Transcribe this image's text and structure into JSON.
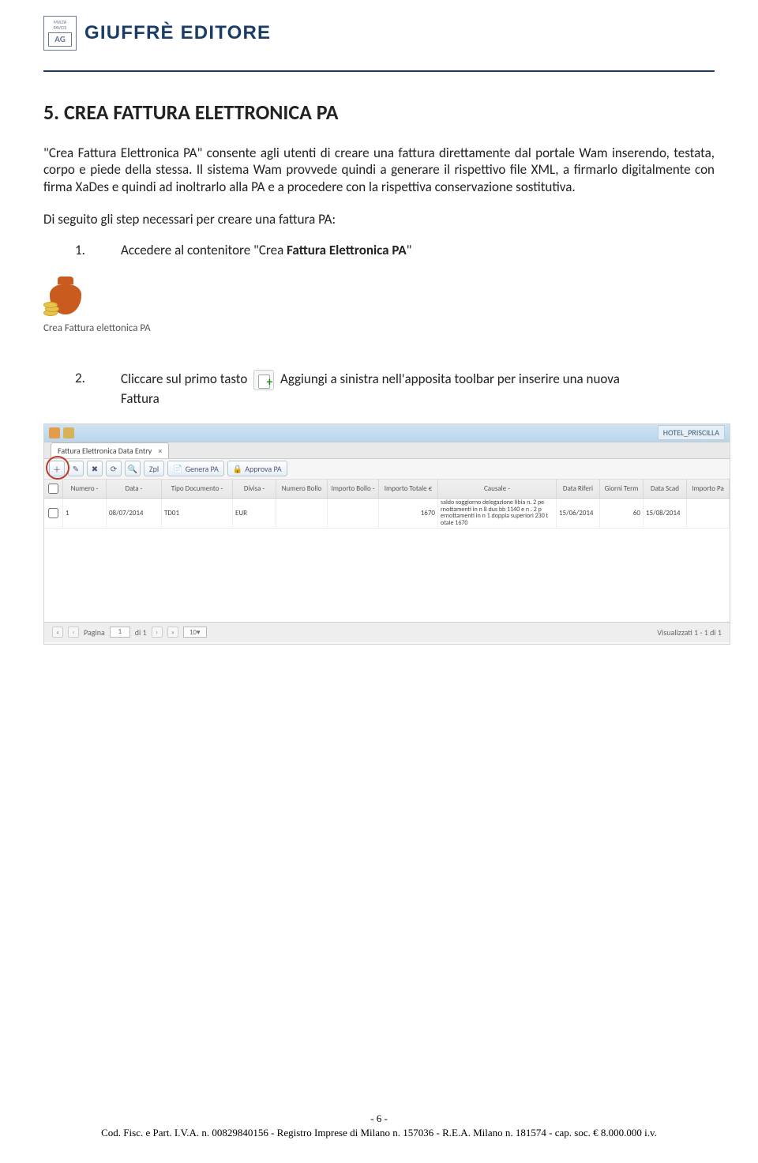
{
  "header": {
    "logo_small_top": "MVLTA",
    "logo_small_bottom": "PAVCIS",
    "logo_ag": "AG",
    "brand": "GIUFFRÈ EDITORE"
  },
  "title": "5. CREA FATTURA ELETTRONICA PA",
  "paragraph": "\"Crea Fattura Elettronica PA\" consente agli utenti di creare una fattura direttamente dal portale Wam inserendo, testata, corpo e piede della stessa. Il sistema Wam provvede quindi a generare il rispettivo file XML, a firmarlo digitalmente con firma XaDes e quindi ad inoltrarlo alla PA e a procedere con la rispettiva conservazione sostitutiva.",
  "step_lead": "Di seguito gli step necessari per creare una fattura PA:",
  "steps": {
    "one_num": "1.",
    "one_pre": "Accedere al contenitore \"Crea ",
    "one_bold": "Fattura Elettronica PA",
    "one_post": "\"",
    "icon_label": "Crea Fattura elettonica PA",
    "two_num": "2.",
    "two_pre": "Cliccare sul primo tasto ",
    "two_post": " Aggiungi a sinistra nell'apposita toolbar per inserire una nuova",
    "two_line2": "Fattura"
  },
  "app": {
    "right_label": "HOTEL_PRISCILLA",
    "tab_title": "Fattura Elettronica Data Entry",
    "toolbar": {
      "zpl": "Zpl",
      "genera": "Genera PA",
      "approva": "Approva PA"
    },
    "cols": {
      "numero": "Numero -",
      "data": "Data -",
      "tipo": "Tipo Documento - ",
      "divisa": "Divisa - ",
      "nbollo": "Numero Bollo",
      "ibollo": "Importo Bollo -",
      "itot": "Importo Totale €",
      "causale": "Causale - ",
      "datarif": "Data Riferi",
      "giorni": "Giorni Term",
      "datascad": "Data Scad",
      "ipa": "Importo Pa"
    },
    "row": {
      "numero": "1",
      "data": "08/07/2014",
      "tipo": "TD01",
      "divisa": "EUR",
      "nbollo": "",
      "ibollo": "",
      "itot": "1670",
      "causale": "saldo soggiorno delegazione libia  n. 2 pe rnottamenti in n 8 dus bb  1140  e n . 2 p ernottamenti in n 1 doppia superiori 230 t otale 1670",
      "datarif": "15/06/2014",
      "giorni": "60",
      "datascad": "15/08/2014",
      "ipa": ""
    },
    "pager": {
      "label_pagina": "Pagina",
      "cur": "1",
      "di": "di 1",
      "size": "10",
      "right": "Visualizzati 1 - 1 di 1"
    }
  },
  "footer": {
    "page": "- 6 -",
    "line": "Cod. Fisc. e Part. I.V.A. n. 00829840156 - Registro Imprese di Milano n. 157036 - R.E.A. Milano n. 181574 - cap. soc. € 8.000.000 i.v."
  }
}
